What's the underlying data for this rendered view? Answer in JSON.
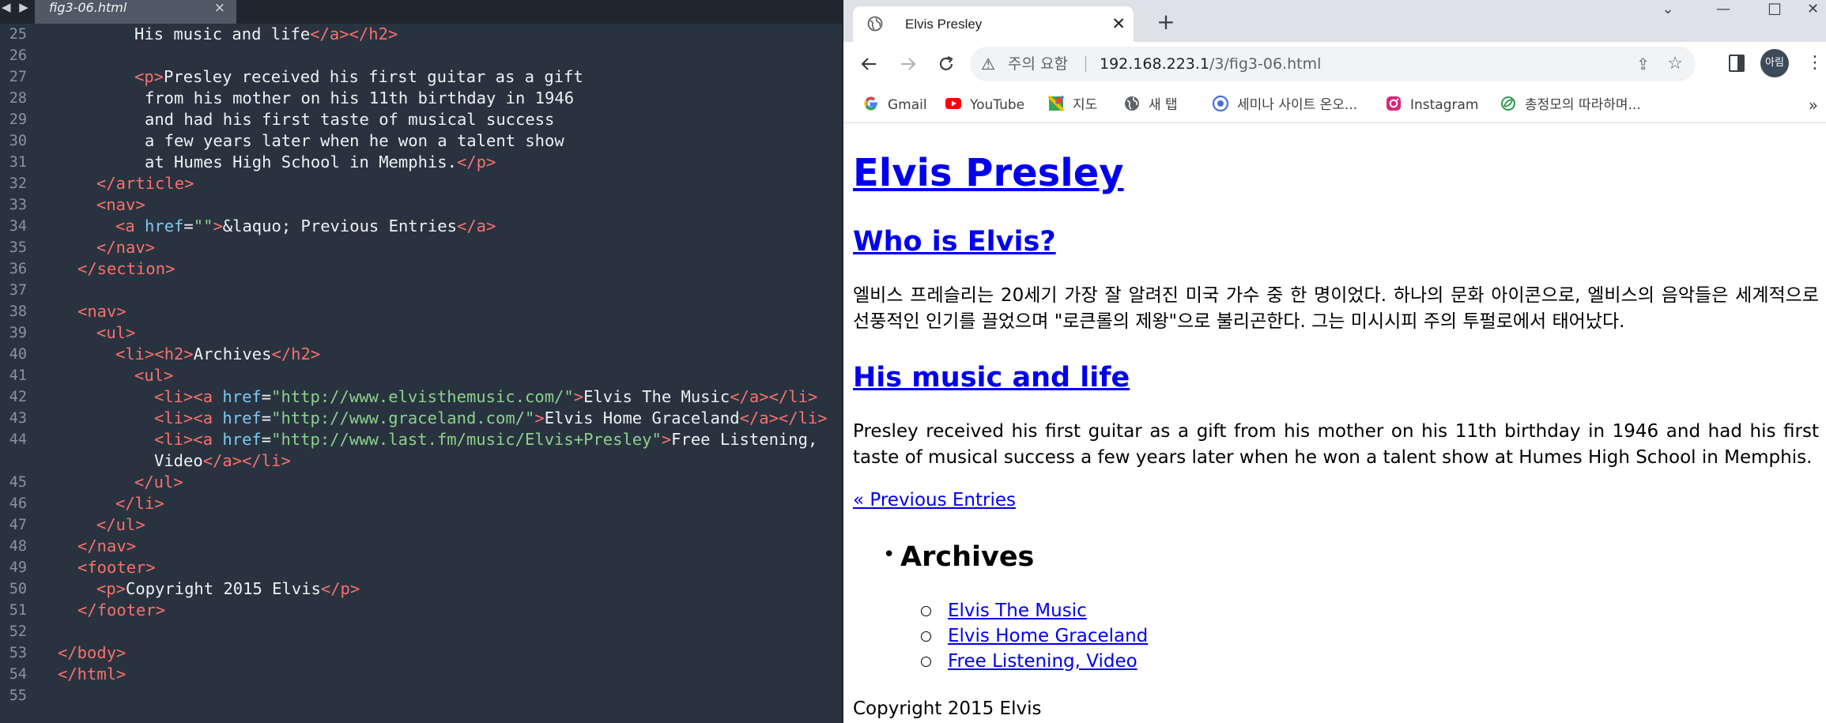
{
  "editor": {
    "tab_filename": "fig3-06.html",
    "tab_close": "×",
    "nav_arrows": "◀ ▶"
  },
  "browser": {
    "tab_title": "Elvis Presley",
    "tab_close": "✕",
    "new_tab": "+",
    "window_controls": {
      "dropdown": "⌄",
      "minimize": "—",
      "maximize": "☐",
      "close": "✕"
    },
    "address": {
      "security_label": "주의 요함",
      "url_host": "192.168.223.1",
      "url_path": "/3/fig3-06.html"
    },
    "profile_label": "아림",
    "bookmarks": [
      {
        "label": "Gmail",
        "icon": "google-icon"
      },
      {
        "label": "YouTube",
        "icon": "youtube-icon"
      },
      {
        "label": "지도",
        "icon": "maps-icon"
      },
      {
        "label": "새 탭",
        "icon": "globe-icon"
      },
      {
        "label": "세미나 사이트 온오...",
        "icon": "target-icon"
      },
      {
        "label": "Instagram",
        "icon": "instagram-icon"
      },
      {
        "label": "총정모의 따라하며...",
        "icon": "leaf-icon"
      }
    ],
    "bookmarks_more": "»"
  },
  "page": {
    "h1": "Elvis Presley",
    "who_title": "Who is Elvis?",
    "who_text": "엘비스 프레슬리는 20세기 가장 잘 알려진 미국 가수 중 한 명이었다. 하나의 문화 아이콘으로, 엘비스의 음악들은 세계적으로 선풍적인 인기를 끌었으며 \"로큰롤의 제왕\"으로 불리곤한다. 그는 미시시피 주의 투펄로에서 태어났다.",
    "music_title": "His music and life",
    "music_text": "Presley received his first guitar as a gift from his mother on his 11th birthday in 1946 and had his first taste of musical success a few years later when he won a talent show at Humes High School in Memphis.",
    "prev_link": "« Previous Entries",
    "archives_title": "Archives",
    "archive_links": [
      "Elvis The Music",
      "Elvis Home Graceland",
      "Free Listening, Video"
    ],
    "footer": "Copyright 2015 Elvis"
  },
  "colors": {
    "editor_bg": "#293340",
    "tag": "#f9706b",
    "attribute": "#7dc8f0",
    "string": "#8dd08a",
    "link": "#0000ee"
  }
}
